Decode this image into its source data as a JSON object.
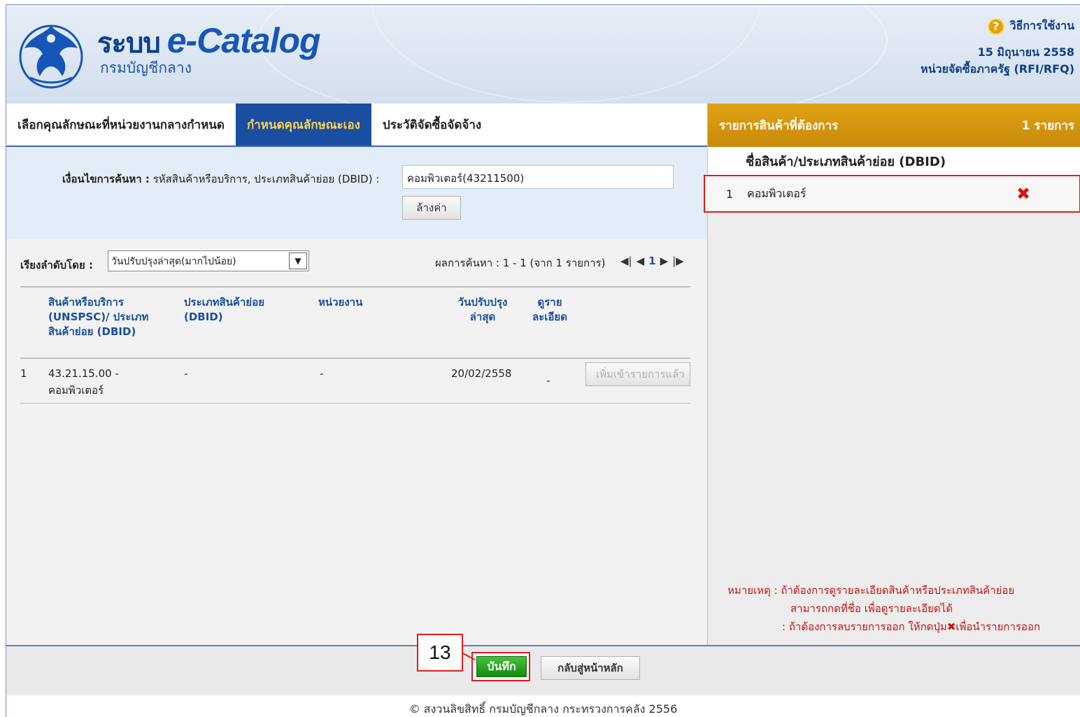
{
  "header": {
    "title_thai": "ระบบ",
    "title": "e-Catalog",
    "subtitle": "กรมบัญชีกลาง",
    "emblem_text": "กรมบัญชีกลาง",
    "help_label": "วิธีการใช้งาน",
    "date": "15 มิถุนายน 2558",
    "unit": "หน่วยจัดซื้อภาครัฐ (RFI/RFQ)"
  },
  "tabs": [
    {
      "label": "เลือกคุณลักษณะที่หน่วยงานกลางกำหนด"
    },
    {
      "label": "กำหนดคุณลักษณะเอง"
    },
    {
      "label": "ประวัติจัดซื้อจัดจ้าง"
    }
  ],
  "search": {
    "condition_label_bold": "เงื่อนไขการค้นหา :",
    "condition_label": "รหัสสินค้าหรือบริการ, ประเภทสินค้าย่อย (DBID) :",
    "condition_value": "คอมพิวเตอร์(43211500)",
    "clear_label": "ล้างค่า"
  },
  "sort": {
    "label": "เรียงลำดับโดย :",
    "selected": "วันปรับปรุงล่าสุด(มากไปน้อย)"
  },
  "results": {
    "info": "ผลการค้นหา :  1 - 1 (จาก 1 รายการ)",
    "current_page": "1"
  },
  "table": {
    "headers": {
      "product": "สินค้าหรือบริการ (UNSPSC)/ ประเภทสินค้าย่อย (DBID)",
      "subtype": "ประเภทสินค้าย่อย (DBID)",
      "agency": "หน่วยงาน",
      "updated": "วันปรับปรุง ล่าสุด",
      "detail": "ดูราย ละเอียด"
    },
    "rows": [
      {
        "no": "1",
        "product": "43.21.15.00 - คอมพิวเตอร์",
        "subtype": "-",
        "agency": "-",
        "updated": "20/02/2558",
        "detail": "-",
        "action": "เพิ่มเข้ารายการแล้ว"
      }
    ]
  },
  "cart": {
    "title": "รายการสินค้าที่ต้องการ",
    "count": "1 รายการ",
    "column": "ชื่อสินค้า/ประเภทสินค้าย่อย (DBID)",
    "items": [
      {
        "no": "1",
        "name": "คอมพิวเตอร์"
      }
    ],
    "note_label": "หมายเหตุ :",
    "note_1": "ถ้าต้องการดูรายละเอียดสินค้าหรือประเภทสินค้าย่อย",
    "note_2": "สามารถกดที่ชื่อ เพื่อดูรายละเอียดได้",
    "note_3a": ": ถ้าต้องการลบรายการออก ให้กดปุ่ม",
    "note_3b": "เพื่อนำรายการออก"
  },
  "footer": {
    "save_label": "บันทึก",
    "back_label": "กลับสู่หน้าหลัก",
    "callout": "13",
    "copyright": "© สงวนลิขสิทธิ์ กรมบัญชีกลาง กระทรวงการคลัง 2556"
  },
  "colors": {
    "accent": "#1a4ea0",
    "cart_header": "#d49612",
    "highlight": "#e31b1b",
    "save": "#1a9a1a"
  }
}
